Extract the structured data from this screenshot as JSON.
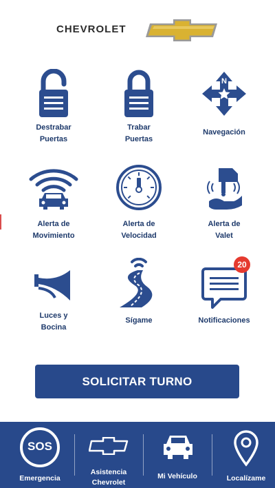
{
  "header": {
    "brand": "CHEVROLET",
    "logo_icon": "chevrolet-bowtie-logo"
  },
  "colors": {
    "primary": "#28498b",
    "icon": "#2c4d8f",
    "label": "#1e3a6b",
    "badge": "#e53a2f",
    "logo_gold": "#d9b232"
  },
  "tiles": [
    {
      "label1": "Destrabar",
      "label2": "Puertas",
      "icon": "unlock-icon"
    },
    {
      "label1": "Trabar",
      "label2": "Puertas",
      "icon": "lock-icon"
    },
    {
      "label1": "Navegación",
      "label2": "",
      "icon": "navigation-compass-icon"
    },
    {
      "label1": "Alerta de",
      "label2": "Movimiento",
      "icon": "car-signal-icon"
    },
    {
      "label1": "Alerta de",
      "label2": "Velocidad",
      "icon": "speedometer-icon"
    },
    {
      "label1": "Alerta de",
      "label2": "Valet",
      "icon": "valet-key-icon"
    },
    {
      "label1": "Luces y",
      "label2": "Bocina",
      "icon": "horn-icon"
    },
    {
      "label1": "Sígame",
      "label2": "",
      "icon": "road-follow-icon"
    },
    {
      "label1": "Notificaciones",
      "label2": "",
      "icon": "message-icon",
      "badge": "20"
    }
  ],
  "cta": {
    "label": "SOLICITAR TURNO"
  },
  "bottom_nav": [
    {
      "label1": "Emergencia",
      "label2": "",
      "icon": "sos-icon",
      "icon_text": "SOS"
    },
    {
      "label1": "Asistencia",
      "label2": "Chevrolet",
      "icon": "chevrolet-bowtie-icon"
    },
    {
      "label1": "Mi Vehículo",
      "label2": "",
      "icon": "car-icon"
    },
    {
      "label1": "Localízame",
      "label2": "",
      "icon": "location-pin-icon"
    }
  ]
}
